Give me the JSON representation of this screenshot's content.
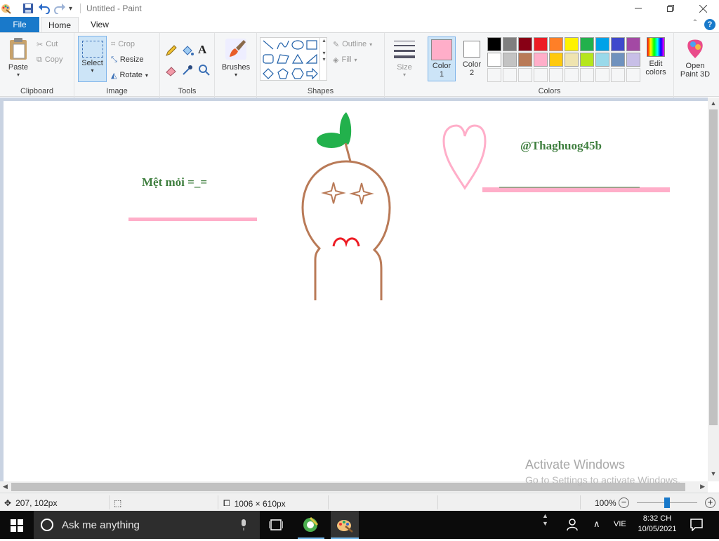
{
  "window": {
    "title": "Untitled - Paint"
  },
  "tabs": {
    "file": "File",
    "home": "Home",
    "view": "View"
  },
  "help": "?",
  "ribbon": {
    "clipboard": {
      "paste": "Paste",
      "cut": "Cut",
      "copy": "Copy",
      "label": "Clipboard"
    },
    "image": {
      "select": "Select",
      "crop": "Crop",
      "resize": "Resize",
      "rotate": "Rotate",
      "label": "Image"
    },
    "tools": {
      "label": "Tools",
      "text_tool": "A"
    },
    "brushes": {
      "label": "Brushes"
    },
    "shapes": {
      "outline": "Outline",
      "fill": "Fill",
      "label": "Shapes"
    },
    "size": {
      "label": "Size"
    },
    "colors": {
      "color1": "Color\n1",
      "color1_line1": "Color",
      "color1_line2": "1",
      "color2_line1": "Color",
      "color2_line2": "2",
      "color1_value": "#ffaec9",
      "color2_value": "#ffffff",
      "edit_line1": "Edit",
      "edit_line2": "colors",
      "label": "Colors",
      "palette_row1": [
        "#000000",
        "#7f7f7f",
        "#880015",
        "#ed1c24",
        "#ff7f27",
        "#fff200",
        "#22b14c",
        "#00a2e8",
        "#3f48cc",
        "#a349a4"
      ],
      "palette_row2": [
        "#ffffff",
        "#c3c3c3",
        "#b97a57",
        "#ffaec9",
        "#ffc90e",
        "#efe4b0",
        "#b5e61d",
        "#99d9ea",
        "#7092be",
        "#c8bfe7"
      ]
    },
    "paint3d": {
      "line1": "Open",
      "line2": "Paint 3D"
    }
  },
  "canvas": {
    "text_left": "Mệt mỏi =_=",
    "text_right": "@Thaghuog45b",
    "colors": {
      "pink": "#ffaec9",
      "green_text": "#3f7f3f",
      "brown": "#b97a57",
      "leaf": "#22b14c",
      "red": "#ed1c24"
    }
  },
  "status": {
    "cursor_pos": "207, 102px",
    "canvas_size": "1006 × 610px",
    "zoom": "100%"
  },
  "watermark": {
    "line1": "Activate Windows",
    "line2": "Go to Settings to activate Windows."
  },
  "taskbar": {
    "search_placeholder": "Ask me anything",
    "lang": "VIE",
    "time": "8:32 CH",
    "date": "10/05/2021"
  }
}
